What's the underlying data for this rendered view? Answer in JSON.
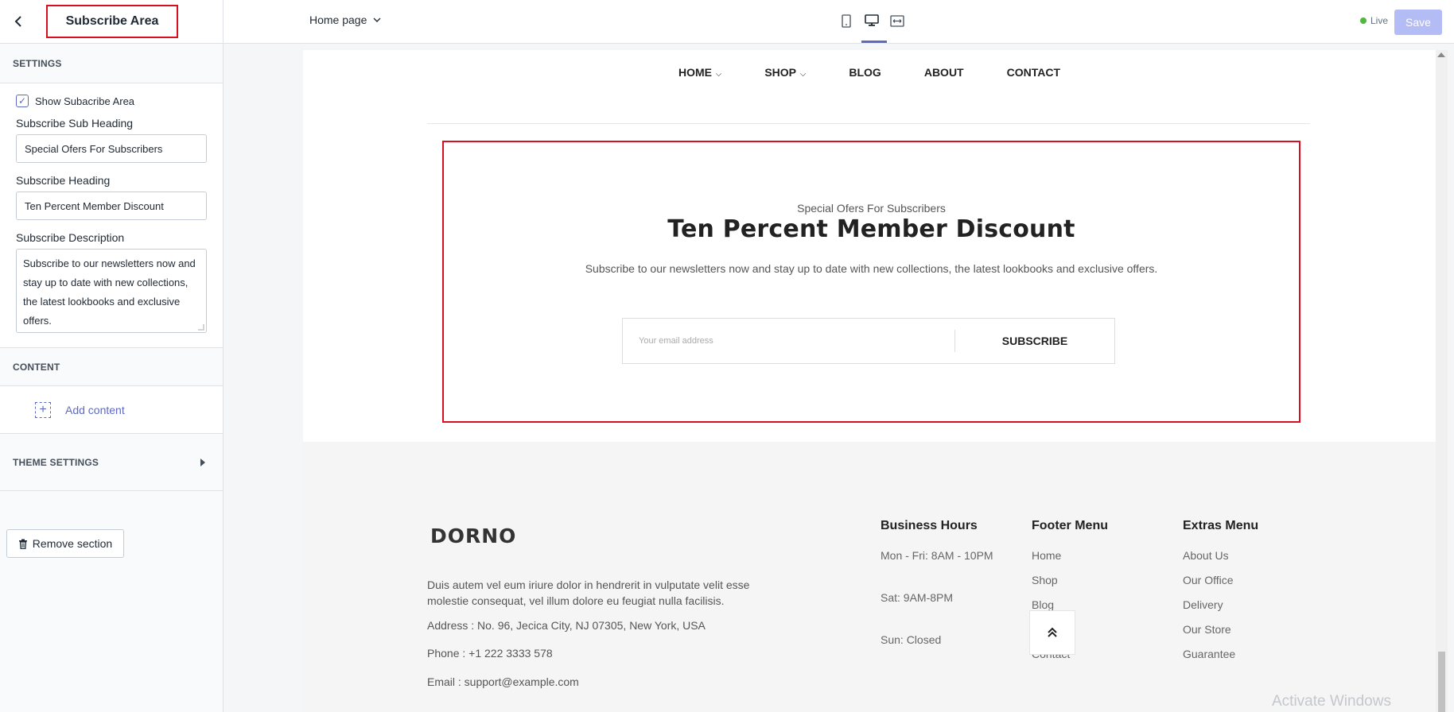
{
  "sidebar": {
    "title": "Subscribe Area",
    "settings_label": "SETTINGS",
    "show_checkbox_label": "Show Subacribe Area",
    "sub_heading_label": "Subscribe Sub Heading",
    "sub_heading_value": "Special Ofers For Subscribers",
    "heading_label": "Subscribe Heading",
    "heading_value": "Ten Percent Member Discount",
    "description_label": "Subscribe Description",
    "description_value": "Subscribe to our newsletters now and stay up to date with new collections, the latest lookbooks and exclusive offers.",
    "content_label": "CONTENT",
    "add_content_label": "Add content",
    "theme_settings_label": "THEME SETTINGS",
    "remove_section_label": "Remove section"
  },
  "topbar": {
    "page_select": "Home page",
    "live_label": "Live",
    "save_label": "Save"
  },
  "site": {
    "nav": [
      {
        "label": "HOME",
        "dropdown": true
      },
      {
        "label": "SHOP",
        "dropdown": true
      },
      {
        "label": "BLOG",
        "dropdown": false
      },
      {
        "label": "ABOUT",
        "dropdown": false
      },
      {
        "label": "CONTACT",
        "dropdown": false
      }
    ],
    "subscribe": {
      "sub_heading": "Special Ofers For Subscribers",
      "heading": "Ten Percent Member Discount",
      "description": "Subscribe to our newsletters now and stay up to date with new collections, the latest lookbooks and exclusive offers.",
      "email_placeholder": "Your email address",
      "button": "SUBSCRIBE"
    },
    "footer": {
      "logo": "DORNO",
      "description": "Duis autem vel eum iriure dolor in hendrerit in vulputate velit esse molestie consequat, vel illum dolore eu feugiat nulla facilisis.",
      "address": "Address : No. 96, Jecica City, NJ 07305, New York, USA",
      "phone": "Phone : +1 222 3333 578",
      "email": "Email : support@example.com",
      "hours_title": "Business Hours",
      "hours": [
        "Mon - Fri: 8AM - 10PM",
        "Sat: 9AM-8PM",
        "Sun: Closed"
      ],
      "footer_menu_title": "Footer Menu",
      "footer_menu": [
        "Home",
        "Shop",
        "Blog",
        "About",
        "Contact"
      ],
      "extras_menu_title": "Extras Menu",
      "extras_menu": [
        "About Us",
        "Our Office",
        "Delivery",
        "Our Store",
        "Guarantee"
      ]
    }
  },
  "watermark": "Activate Windows",
  "colors": {
    "highlight": "#d70f1f",
    "accent": "#5c6ac4",
    "live_dot": "#50b83c"
  }
}
